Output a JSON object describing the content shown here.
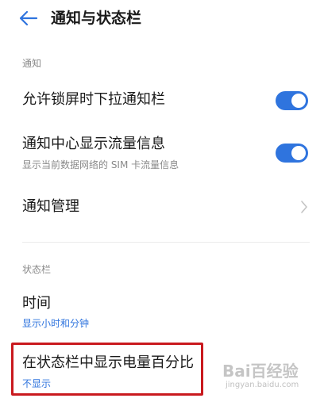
{
  "header": {
    "title": "通知与状态栏"
  },
  "sections": {
    "notification": {
      "label": "通知",
      "rows": [
        {
          "title": "允许锁屏时下拉通知栏",
          "toggle_on": true
        },
        {
          "title": "通知中心显示流量信息",
          "subtitle": "显示当前数据网络的 SIM 卡流量信息",
          "toggle_on": true
        },
        {
          "title": "通知管理"
        }
      ]
    },
    "status_bar": {
      "label": "状态栏",
      "rows": [
        {
          "title": "时间",
          "value": "显示小时和分钟"
        },
        {
          "title": "在状态栏中显示电量百分比",
          "value": "不显示"
        }
      ]
    }
  },
  "colors": {
    "accent": "#2f74de",
    "highlight": "#c9191e"
  },
  "watermark": {
    "logo": "Bai百经验",
    "url": "jingyan.baidu.com"
  }
}
